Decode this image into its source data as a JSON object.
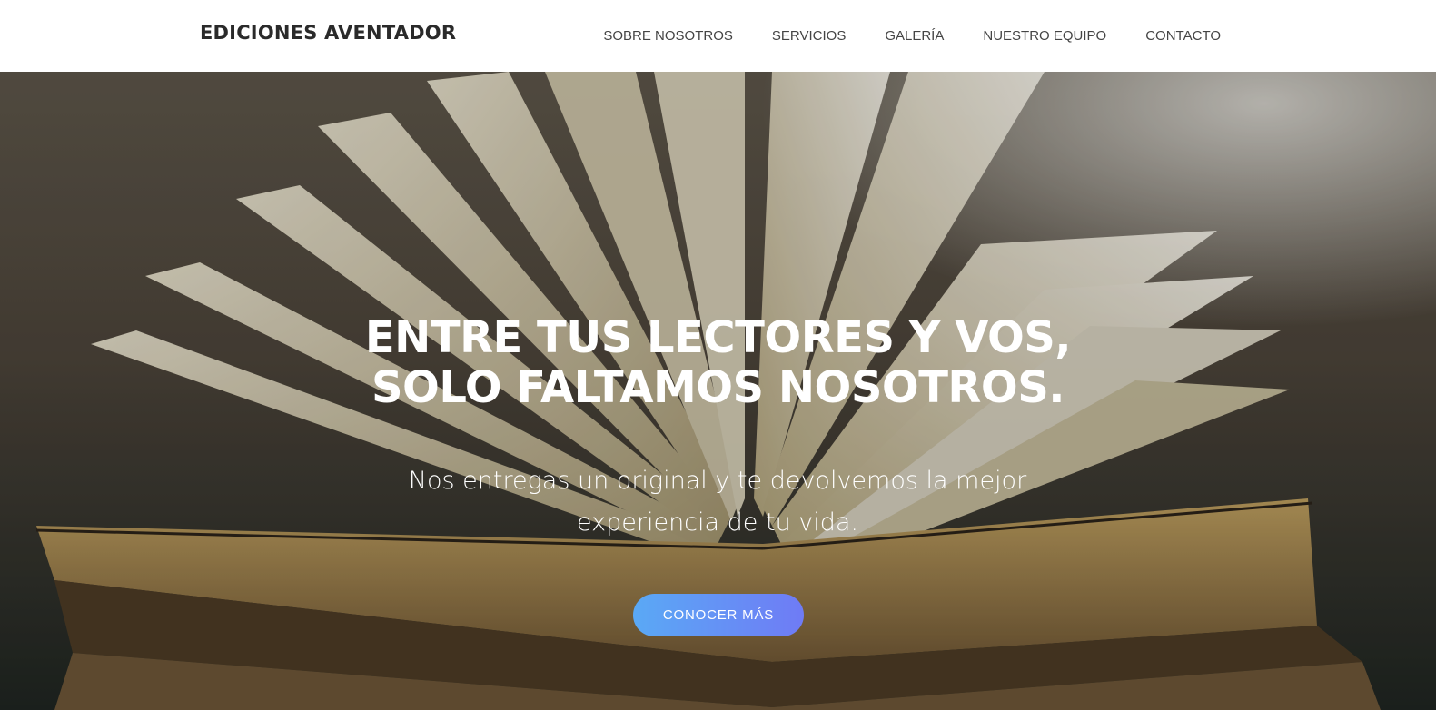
{
  "navbar": {
    "brand": "EDICIONES AVENTADOR",
    "links": [
      {
        "label": "SOBRE NOSOTROS"
      },
      {
        "label": "SERVICIOS"
      },
      {
        "label": "GALERÍA"
      },
      {
        "label": "NUESTRO EQUIPO"
      },
      {
        "label": "CONTACTO"
      }
    ]
  },
  "hero": {
    "headline_line1": "ENTRE TUS LECTORES Y VOS,",
    "headline_line2": "SOLO FALTAMOS NOSOTROS.",
    "subtitle_line1": "Nos entregas un original y te devolvemos la mejor",
    "subtitle_line2": "experiencia de tu vida.",
    "cta_label": "CONOCER MÁS",
    "background_image": "open-book-photo",
    "accent_gradient": [
      "#5aa9f5",
      "#6f7bf5"
    ]
  }
}
